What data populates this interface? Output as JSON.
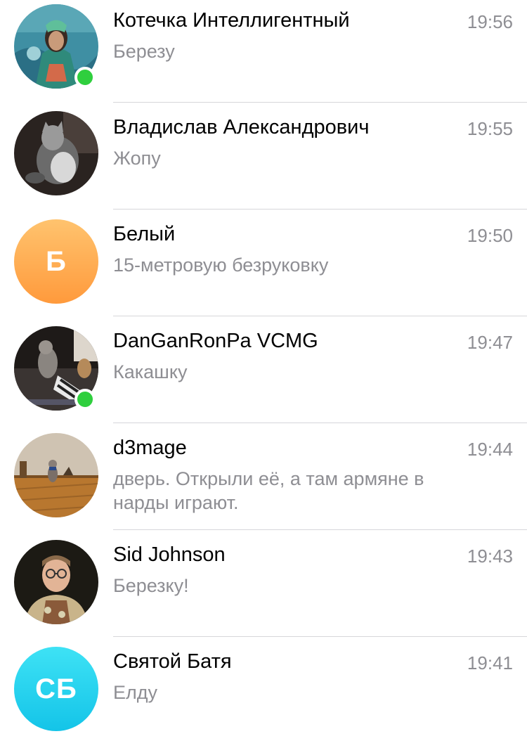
{
  "chats": [
    {
      "name": "Котечка Интеллигентный",
      "time": "19:56",
      "message": "Березу",
      "online": true
    },
    {
      "name": "Владислав Александрович",
      "time": "19:55",
      "message": "Жопу",
      "online": false
    },
    {
      "name": "Белый",
      "time": "19:50",
      "message": "15-метровую безруковку",
      "online": false,
      "initials": "Б"
    },
    {
      "name": "DanGanRonPa VCMG",
      "time": "19:47",
      "message": "Какашку",
      "online": true
    },
    {
      "name": "d3mage",
      "time": "19:44",
      "message": "дверь. Открыли её, а там армяне в нарды играют.",
      "online": false
    },
    {
      "name": "Sid Johnson",
      "time": "19:43",
      "message": "Березку!",
      "online": false
    },
    {
      "name": "Святой Батя",
      "time": "19:41",
      "message": "Елду",
      "online": false,
      "initials": "СБ"
    }
  ],
  "colors": {
    "online": "#2fcf3e",
    "time": "#8e8e93",
    "message": "#8e8e93",
    "avatar_orange_top": "#ffc36e",
    "avatar_orange_bottom": "#ff9a3c",
    "avatar_cyan_top": "#3ee2f5",
    "avatar_cyan_bottom": "#14c4e8"
  }
}
